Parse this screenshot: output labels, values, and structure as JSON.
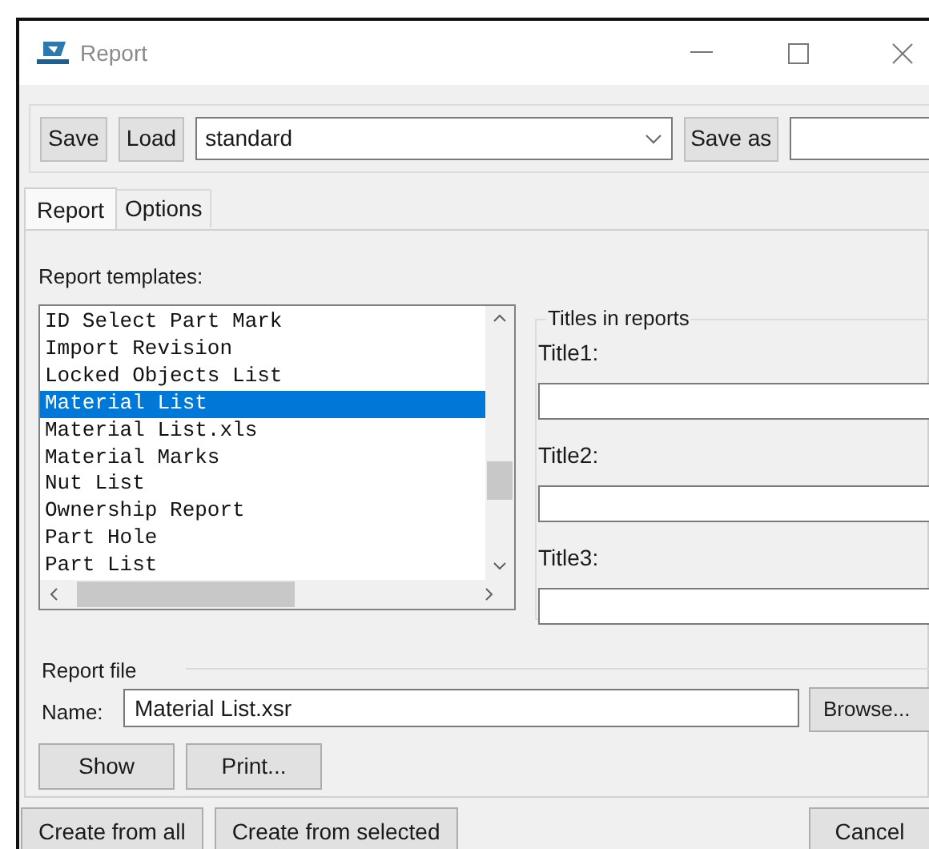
{
  "window": {
    "title": "Report"
  },
  "toolbar": {
    "buttons": [
      "Save",
      "Load"
    ],
    "preset": "standard",
    "save_as_button": "Save as"
  },
  "tabs": [
    {
      "label": "Report",
      "selected": true
    },
    {
      "label": "Options",
      "selected": false
    }
  ],
  "templates": {
    "label": "Report templates:",
    "items": [
      {
        "label": "ID Select Part Mark",
        "selected": false
      },
      {
        "label": "Import Revision",
        "selected": false
      },
      {
        "label": "Locked Objects List",
        "selected": false
      },
      {
        "label": "Material List",
        "selected": true
      },
      {
        "label": "Material List.xls",
        "selected": false
      },
      {
        "label": "Material Marks",
        "selected": false
      },
      {
        "label": "Nut List",
        "selected": false
      },
      {
        "label": "Ownership Report",
        "selected": false
      },
      {
        "label": "Part Hole",
        "selected": false
      },
      {
        "label": "Part List",
        "selected": false
      }
    ]
  },
  "titles": {
    "legend": "Titles in reports",
    "fields": [
      {
        "label": "Title1:"
      },
      {
        "label": "Title2:"
      },
      {
        "label": "Title3:"
      }
    ]
  },
  "report_file": {
    "legend": "Report file",
    "name_label": "Name:",
    "name_value": "Material List.xsr",
    "browse_button": "Browse..."
  },
  "actions": [
    "Show",
    "Print..."
  ],
  "footer": {
    "buttons": [
      "Create from all",
      "Create from selected"
    ],
    "cancel_button": "Cancel"
  }
}
